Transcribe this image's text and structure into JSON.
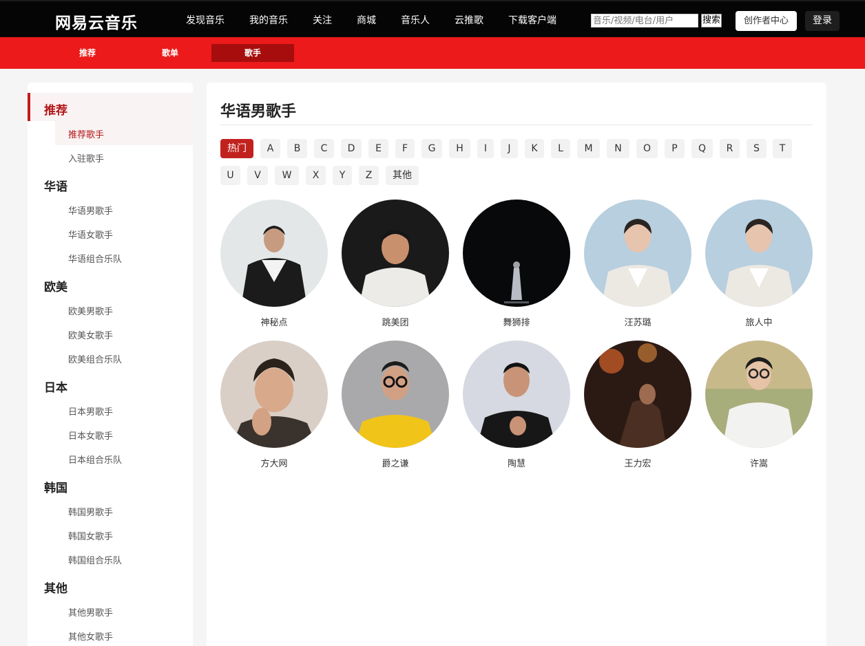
{
  "header": {
    "logo": "网易云音乐",
    "nav": [
      "发现音乐",
      "我的音乐",
      "关注",
      "商城",
      "音乐人",
      "云推歌",
      "下载客户端"
    ],
    "search_placeholder": "音乐/视频/电台/用户",
    "search_button": "搜索",
    "creator_center": "创作者中心",
    "login": "登录"
  },
  "subnav": {
    "items": [
      "推荐",
      "歌单",
      "歌手"
    ],
    "active": "歌手"
  },
  "sidebar": {
    "groups": [
      {
        "title": "推荐",
        "items": [
          "推荐歌手",
          "入驻歌手"
        ]
      },
      {
        "title": "华语",
        "items": [
          "华语男歌手",
          "华语女歌手",
          "华语组合乐队"
        ]
      },
      {
        "title": "欧美",
        "items": [
          "欧美男歌手",
          "欧美女歌手",
          "欧美组合乐队"
        ]
      },
      {
        "title": "日本",
        "items": [
          "日本男歌手",
          "日本女歌手",
          "日本组合乐队"
        ]
      },
      {
        "title": "韩国",
        "items": [
          "韩国男歌手",
          "韩国女歌手",
          "韩国组合乐队"
        ]
      },
      {
        "title": "其他",
        "items": [
          "其他男歌手",
          "其他女歌手"
        ]
      }
    ],
    "active_group": "推荐",
    "active_item": "推荐歌手"
  },
  "main": {
    "title": "华语男歌手",
    "letters_row1": [
      "热门",
      "A",
      "B",
      "C",
      "D",
      "E",
      "F",
      "G",
      "H",
      "I",
      "J",
      "K",
      "L",
      "M",
      "N",
      "O",
      "P",
      "Q",
      "R",
      "S",
      "T"
    ],
    "letters_row2": [
      "U",
      "V",
      "W",
      "X",
      "Y",
      "Z",
      "其他"
    ],
    "active_letter": "热门",
    "artists": [
      "神秘点",
      "跳美团",
      "舞狮排",
      "汪苏璐",
      "旅人中",
      "方大网",
      "爵之谦",
      "陶慧",
      "王力宏",
      "许嵩"
    ]
  }
}
